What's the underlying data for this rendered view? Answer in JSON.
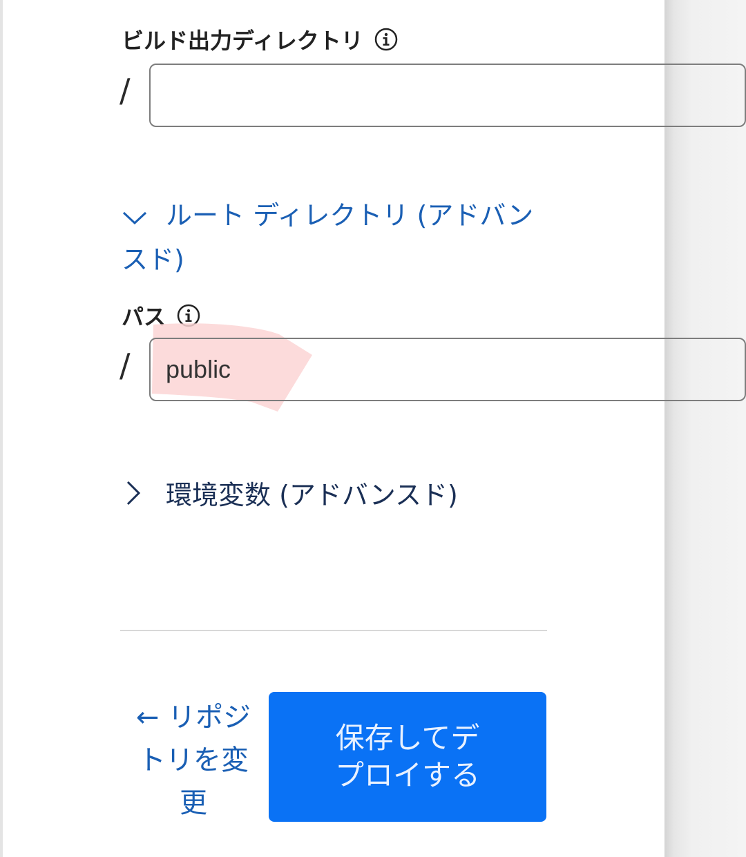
{
  "build_output": {
    "label": "ビルド出力ディレクトリ",
    "prefix": "/",
    "value": "",
    "info_icon": "info-circle-icon"
  },
  "root_directory_section": {
    "label": "ルート ディレクトリ (アドバンスド)",
    "expanded": true,
    "icon": "chevron-down-icon",
    "path": {
      "label": "パス",
      "prefix": "/",
      "value": "public",
      "info_icon": "info-circle-icon"
    }
  },
  "env_section": {
    "label": "環境変数 (アドバンスド)",
    "expanded": false,
    "icon": "chevron-right-icon"
  },
  "footer": {
    "back_label": "← リポジトリを変更",
    "primary_label": "保存してデプロイする"
  },
  "colors": {
    "link": "#1a5fb4",
    "primary_button": "#0a72f5",
    "highlight": "#fcd5d5"
  }
}
